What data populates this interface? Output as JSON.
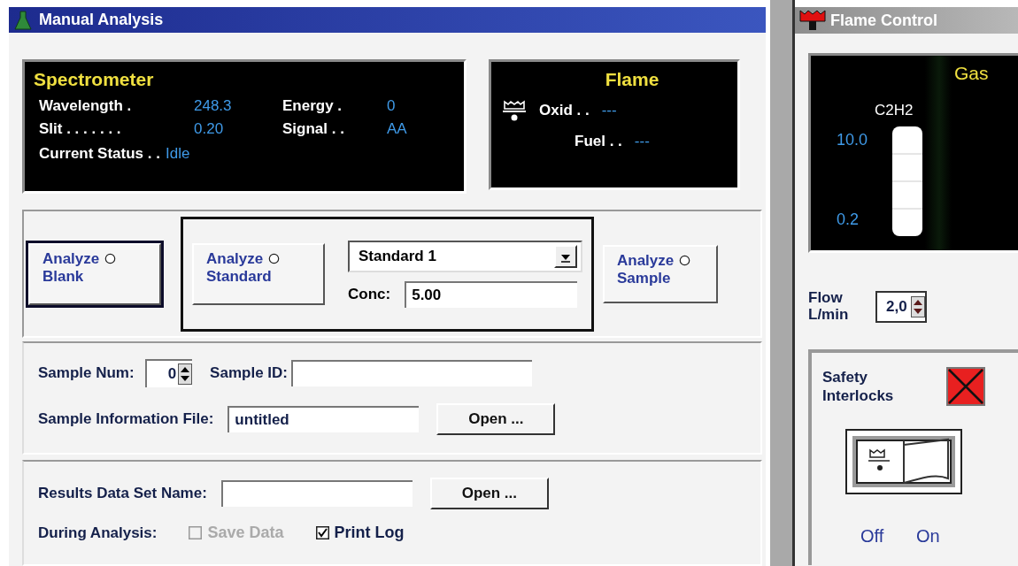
{
  "window": {
    "title": "Manual Analysis"
  },
  "spectrometer": {
    "title": "Spectrometer",
    "readings": [
      {
        "label": "Wavelength .",
        "value": "248.3"
      },
      {
        "label": "Energy .",
        "value": "0"
      },
      {
        "label": "Slit . . . . . . .",
        "value": "0.20"
      },
      {
        "label": "Signal . .",
        "value": "AA"
      }
    ],
    "status": {
      "label": "Current Status . .",
      "value": "Idle"
    }
  },
  "flame": {
    "title": "Flame",
    "readings": [
      {
        "label": "Oxid . .",
        "value": "---"
      },
      {
        "label": "Fuel . .",
        "value": "---"
      }
    ]
  },
  "analyze": {
    "buttons": [
      {
        "label": "Analyze Blank",
        "kind": "blank",
        "default": true,
        "selected": false
      },
      {
        "label": "Analyze Standard",
        "kind": "standard",
        "default": false,
        "selected": false
      },
      {
        "label": "Analyze Sample",
        "kind": "sample",
        "default": false,
        "selected": false
      }
    ],
    "standard_select": "Standard 1",
    "conc_label": "Conc:",
    "conc_value": "5.00"
  },
  "sample": {
    "num_label": "Sample Num:",
    "num_value": "0",
    "id_label": "Sample ID:",
    "file_label": "Sample Information File:",
    "file_value": "untitled",
    "open_button": "Open ..."
  },
  "results": {
    "name_label": "Results Data Set Name:",
    "open_button": "Open ...",
    "during_label": "During Analysis:",
    "options": [
      {
        "label": "Save Data",
        "checked": false,
        "disabled": true
      },
      {
        "label": "Print Log",
        "checked": true,
        "disabled": false
      }
    ]
  },
  "flame_control": {
    "title": "Flame Control",
    "gas_title": "Gas",
    "gauge_label": "C2H2",
    "gauge_max": "10.0",
    "gauge_min": "0.2",
    "flow_label": "Flow L/min",
    "flow_value": "2,0",
    "safety_label": "Safety Interlocks",
    "interlocks_ok": false,
    "switch_on": false,
    "switch_off_label": "Off",
    "switch_on_label": "On"
  }
}
